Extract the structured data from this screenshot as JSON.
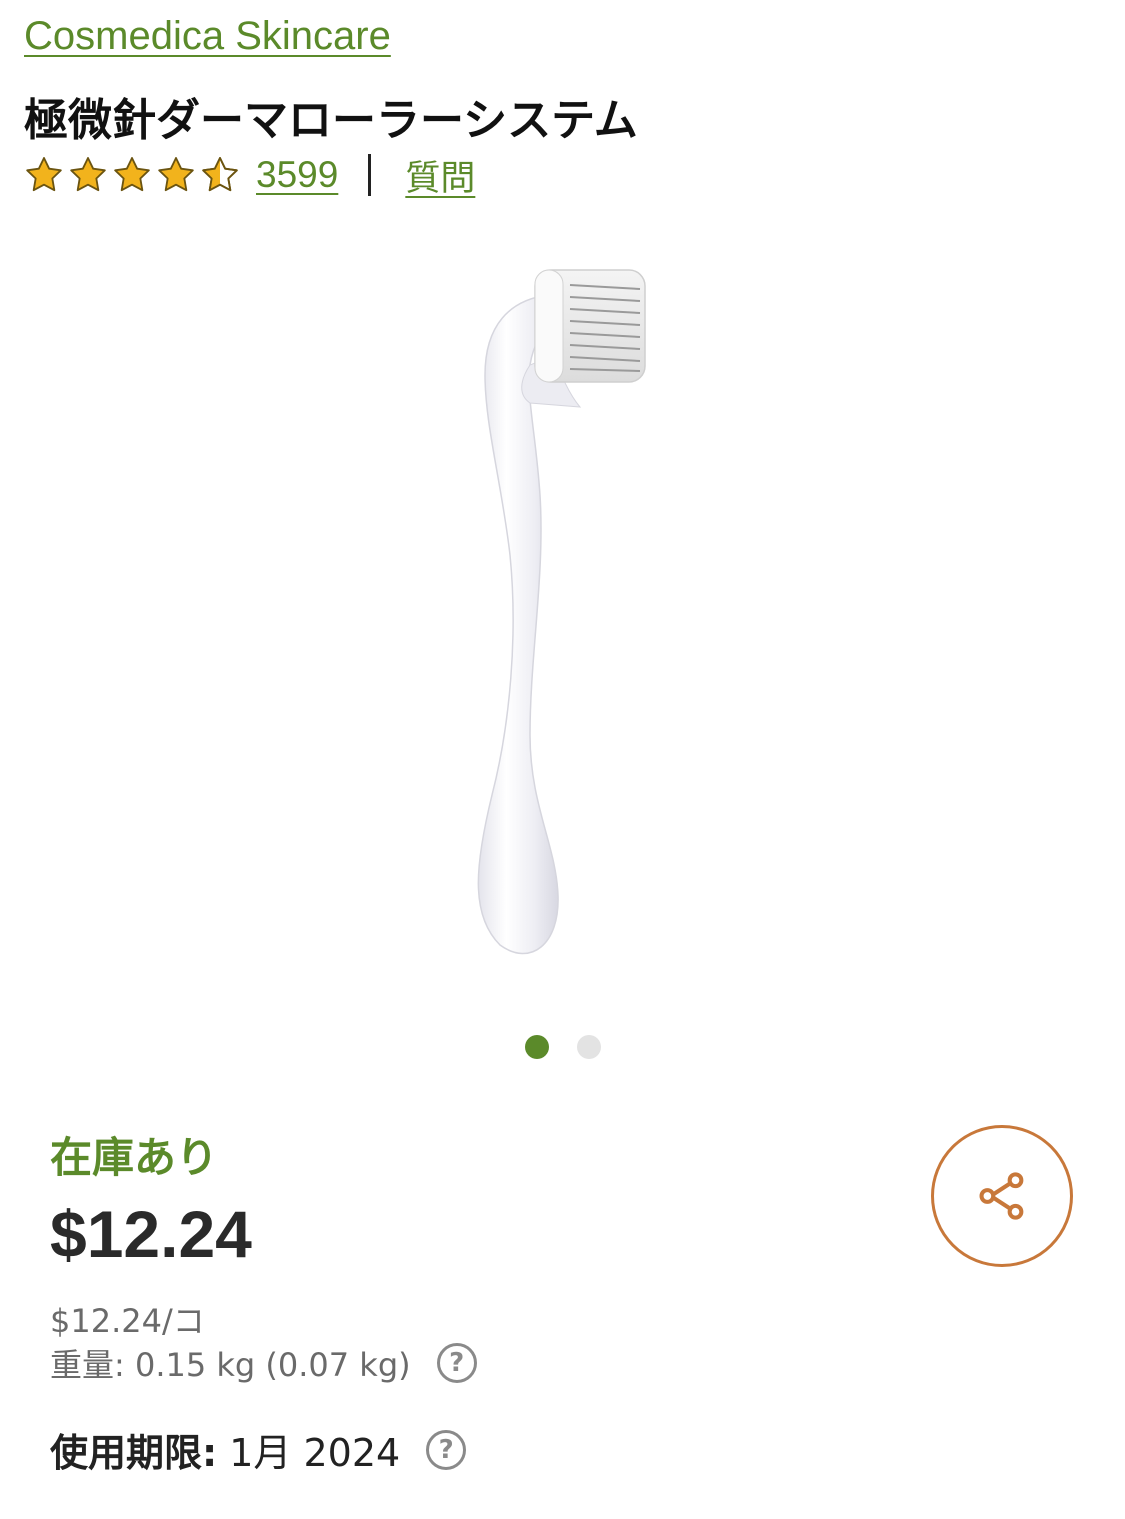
{
  "product": {
    "brand": "Cosmedica Skincare",
    "title": "極微針ダーマローラーシステム",
    "rating": 4.5,
    "rating_max": 5,
    "review_count": "3599",
    "qa_label": "質問",
    "image_icon": "derma-roller-image"
  },
  "carousel": {
    "total": 2,
    "active_index": 0
  },
  "purchase": {
    "stock_status": "在庫あり",
    "price": "$12.24",
    "unit_price": "$12.24/コ",
    "weight": "重量: 0.15 kg (0.07 kg)",
    "expiry_label": "使用期限:",
    "expiry_value": "1月 2024",
    "help_symbol": "?",
    "share_icon": "share-icon"
  },
  "colors": {
    "accent_green": "#5b8a2a",
    "star_gold": "#f2b31c",
    "share_orange": "#c8783a",
    "dot_inactive": "#e3e3e3"
  }
}
